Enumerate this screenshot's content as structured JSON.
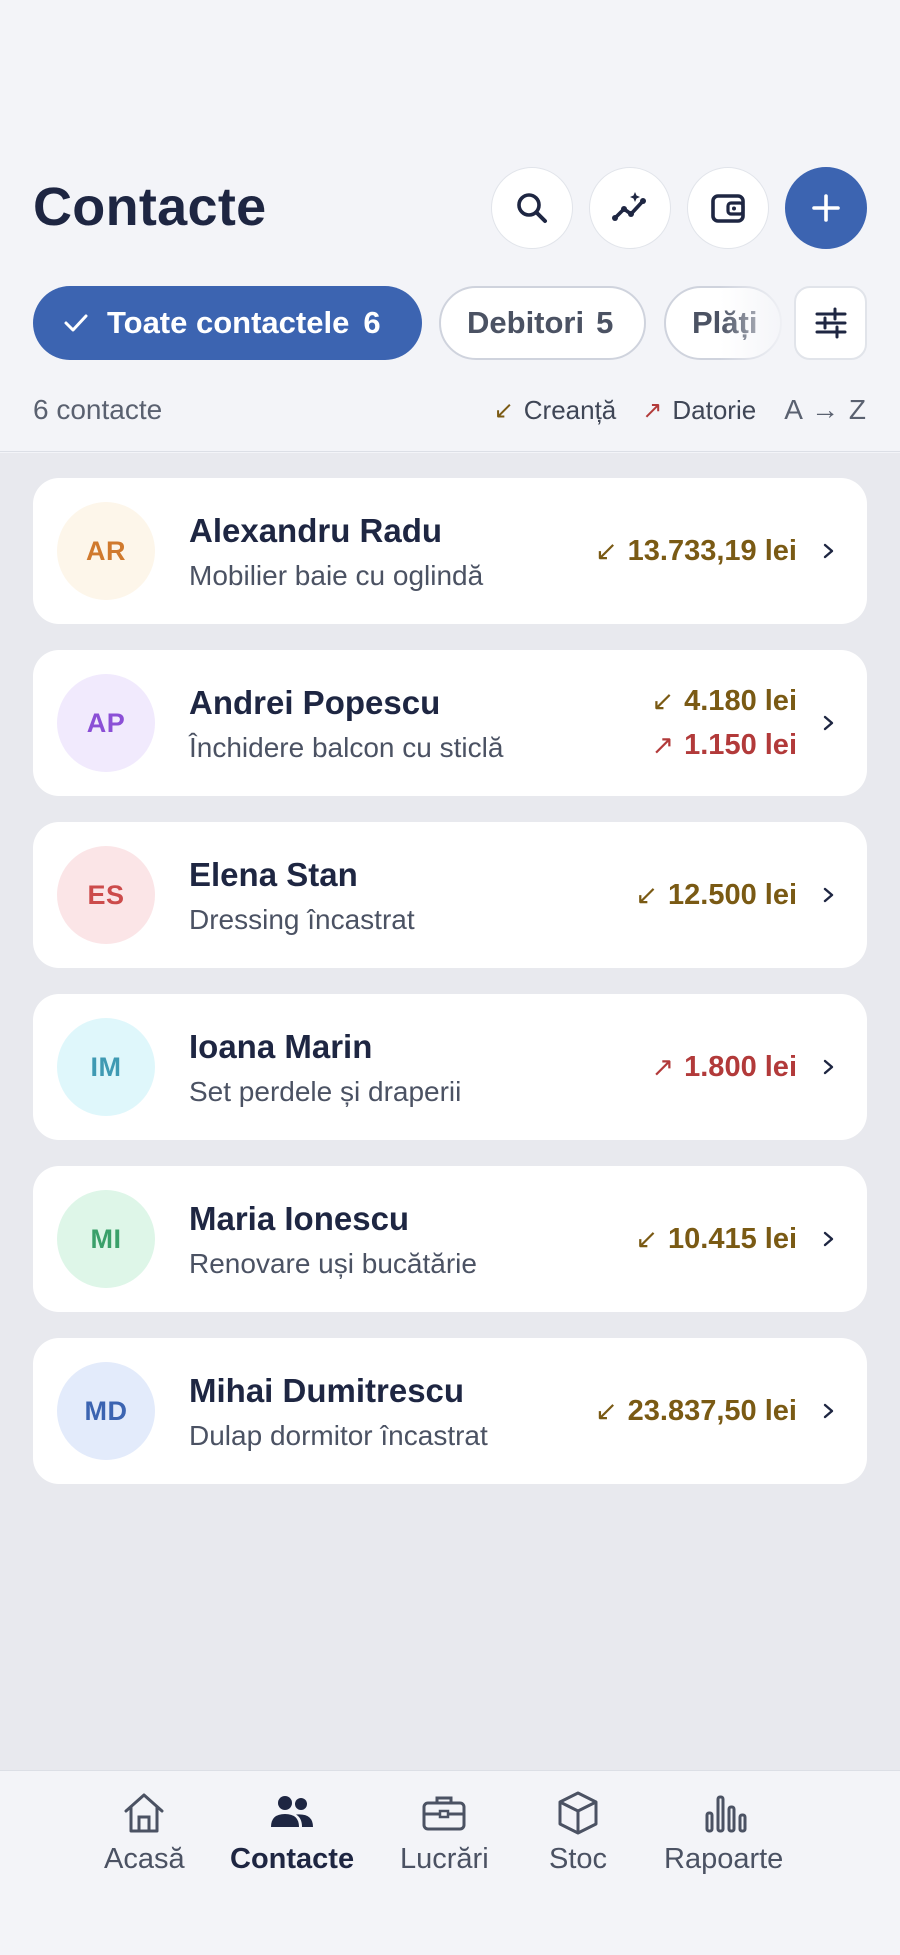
{
  "header": {
    "title": "Contacte",
    "buttons": [
      {
        "icon": "search-icon"
      },
      {
        "icon": "insights-icon"
      },
      {
        "icon": "wallet-icon"
      },
      {
        "icon": "plus-icon"
      }
    ]
  },
  "filters": {
    "all": {
      "label": "Toate contactele",
      "count": "6"
    },
    "debtors": {
      "label": "Debitori",
      "count": "5"
    },
    "payments": {
      "label": "Plăți"
    },
    "settings_icon": "sliders-icon"
  },
  "summary": {
    "count_text": "6 contacte",
    "legend_credit": "Creanță",
    "legend_debt": "Datorie",
    "sort_label": "A → Z",
    "credit_arrow": "↙",
    "debt_arrow": "↗"
  },
  "colors": {
    "accent": "#3c64b1",
    "credit": "#7a5a14",
    "debt": "#b23a3a"
  },
  "contacts": [
    {
      "initials": "AR",
      "name": "Alexandru Radu",
      "subtitle": "Mobilier baie cu oglindă",
      "credit": "13.733,19 lei",
      "debt": "",
      "avatar_bg": "#fdf6ea",
      "avatar_fg": "#d07a2e"
    },
    {
      "initials": "AP",
      "name": "Andrei Popescu",
      "subtitle": "Închidere balcon cu sticlă",
      "credit": "4.180 lei",
      "debt": "1.150 lei",
      "avatar_bg": "#f1eafd",
      "avatar_fg": "#8b4fd6"
    },
    {
      "initials": "ES",
      "name": "Elena Stan",
      "subtitle": "Dressing încastrat",
      "credit": "12.500 lei",
      "debt": "",
      "avatar_bg": "#fbe5e7",
      "avatar_fg": "#cc4b4b"
    },
    {
      "initials": "IM",
      "name": "Ioana Marin",
      "subtitle": "Set perdele și draperii",
      "credit": "",
      "debt": "1.800 lei",
      "avatar_bg": "#dff7fb",
      "avatar_fg": "#3f9ab3"
    },
    {
      "initials": "MI",
      "name": "Maria Ionescu",
      "subtitle": "Renovare uși bucătărie",
      "credit": "10.415 lei",
      "debt": "",
      "avatar_bg": "#def6e8",
      "avatar_fg": "#3aa06a"
    },
    {
      "initials": "MD",
      "name": "Mihai Dumitrescu",
      "subtitle": "Dulap dormitor încastrat",
      "credit": "23.837,50 lei",
      "debt": "",
      "avatar_bg": "#e3ebfb",
      "avatar_fg": "#3c64b1"
    }
  ],
  "nav": [
    {
      "label": "Acasă",
      "icon": "home-icon",
      "active": false
    },
    {
      "label": "Contacte",
      "icon": "people-icon",
      "active": true
    },
    {
      "label": "Lucrări",
      "icon": "briefcase-icon",
      "active": false
    },
    {
      "label": "Stoc",
      "icon": "box-icon",
      "active": false
    },
    {
      "label": "Rapoarte",
      "icon": "bar-chart-icon",
      "active": false
    }
  ]
}
